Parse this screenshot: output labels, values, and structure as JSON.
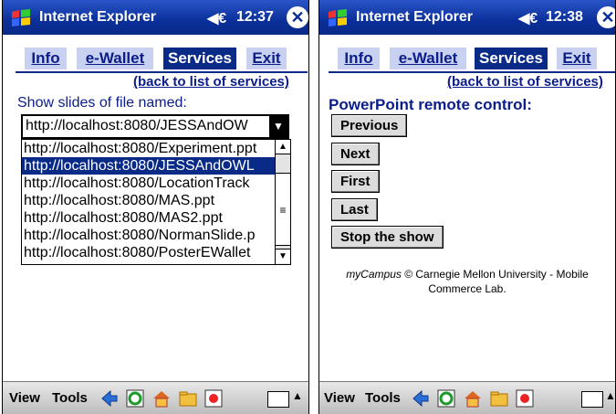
{
  "left_screen": {
    "title": "Internet Explorer",
    "time": "12:37",
    "tabs": [
      "Info",
      "e-Wallet",
      "Services",
      "Exit"
    ],
    "active_tab": "Services",
    "back_link": "(back to list of services)",
    "label": "Show slides of file named:",
    "combo_value": "http://localhost:8080/JESSAndOW",
    "files": [
      "http://localhost:8080/Experiment.ppt",
      "http://localhost:8080/JESSAndOWL",
      "http://localhost:8080/LocationTrack",
      "http://localhost:8080/MAS.ppt",
      "http://localhost:8080/MAS2.ppt",
      "http://localhost:8080/NormanSlide.p",
      "http://localhost:8080/PosterEWallet"
    ],
    "selected_file_index": 1,
    "command_bar": {
      "view": "View",
      "tools": "Tools"
    }
  },
  "right_screen": {
    "title": "Internet Explorer",
    "time": "12:38",
    "tabs": [
      "Info",
      "e-Wallet",
      "Services",
      "Exit"
    ],
    "active_tab": "Services",
    "back_link": "(back to list of services)",
    "heading": "PowerPoint remote control:",
    "buttons": {
      "previous": "Previous",
      "next": "Next",
      "first": "First",
      "last": "Last",
      "stop": "Stop the show"
    },
    "footer_brand": "myCampus",
    "footer_line1": "© Carnegie Mellon University - Mobile",
    "footer_line2": "Commerce Lab.",
    "command_bar": {
      "view": "View",
      "tools": "Tools"
    }
  },
  "colors": {
    "title_bar": "#0a2f99",
    "accent": "#0a2a88",
    "link": "#0b1d8a",
    "tab_inactive": "#c9d1f0"
  },
  "icons": [
    "windows-flag-icon",
    "speaker-icon",
    "close-icon",
    "back-icon",
    "refresh-icon",
    "home-icon",
    "favorites-icon",
    "stop-icon",
    "keyboard-icon"
  ]
}
